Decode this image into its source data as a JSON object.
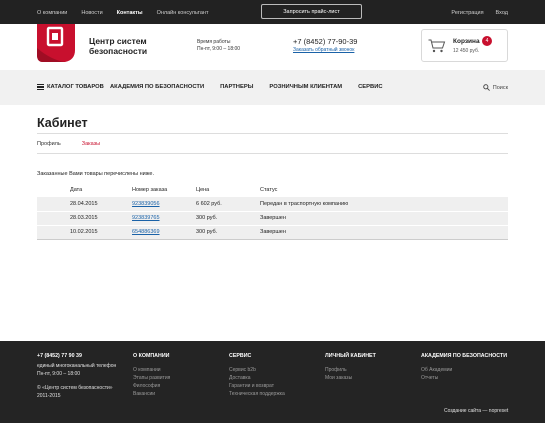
{
  "topbar": {
    "nav": [
      "О компании",
      "Новости",
      "Контакты",
      "Онлайн консультант"
    ],
    "price_button": "Запросить прайс-лист",
    "register": "Регистрация",
    "login": "Вход"
  },
  "header": {
    "brand_line1": "Центр систем",
    "brand_line2": "безопасности",
    "hours_label": "Время работы",
    "hours_value": "Пн-пт, 9:00 – 18:00",
    "phone": "+7 (8452) 77-90-39",
    "callback": "Заказать обратный звонок",
    "cart_title": "Корзина",
    "cart_count": "4",
    "cart_sum": "12 450 руб."
  },
  "nav": {
    "catalog": "КАТАЛОГ ТОВАРОВ",
    "items": [
      "АКАДЕМИЯ ПО БЕЗОПАСНОСТИ",
      "ПАРТНЕРЫ",
      "РОЗНИЧНЫМ КЛИЕНТАМ",
      "СЕРВИС"
    ],
    "search": "Поиск"
  },
  "main": {
    "title": "Кабинет",
    "tabs": [
      "Профиль",
      "Заказы"
    ],
    "intro": "Заказанные Вами товары перечислены ниже."
  },
  "orders": {
    "headers": [
      "Дата",
      "Номер заказа",
      "Цена",
      "Статус"
    ],
    "rows": [
      {
        "date": "28.04.2015",
        "number": "923839056",
        "price": "6 602 руб.",
        "status": "Передан в траспортную компанию"
      },
      {
        "date": "28.03.2015",
        "number": "923839765",
        "price": "300 руб.",
        "status": "Завершен"
      },
      {
        "date": "10.02.2015",
        "number": "654886369",
        "price": "300 руб.",
        "status": "Завершен"
      }
    ]
  },
  "footer": {
    "phone": "+7 (8452) 77 90 39",
    "phone_desc": "единый многоканальный телефон",
    "hours": "Пн-пт, 9:00 – 18:00",
    "copyright": "© «Центр систем безопасности»",
    "years": "2011-2015",
    "col_company": {
      "title": "О КОМПАНИИ",
      "links": [
        "О компании",
        "Этапы развития",
        "Философия",
        "Вакансии"
      ]
    },
    "col_service": {
      "title": "СЕРВИС",
      "links": [
        "Сервис b2b",
        "Доставка",
        "Гарантии и возврат",
        "Техническая поддержка"
      ]
    },
    "col_cabinet": {
      "title": "ЛИЧНЫЙ КАБИНЕТ",
      "links": [
        "Профиль",
        "Мои заказы"
      ]
    },
    "col_academy": {
      "title": "АКАДЕМИЯ ПО БЕЗОПАСНОСТИ",
      "links": [
        "Об Академии",
        "Отчеты"
      ]
    },
    "credit": "Создание сайта — nopreset"
  },
  "colors": {
    "accent": "#c8102e",
    "link": "#1a62a8",
    "dark": "#222222",
    "footer": "#242424"
  }
}
